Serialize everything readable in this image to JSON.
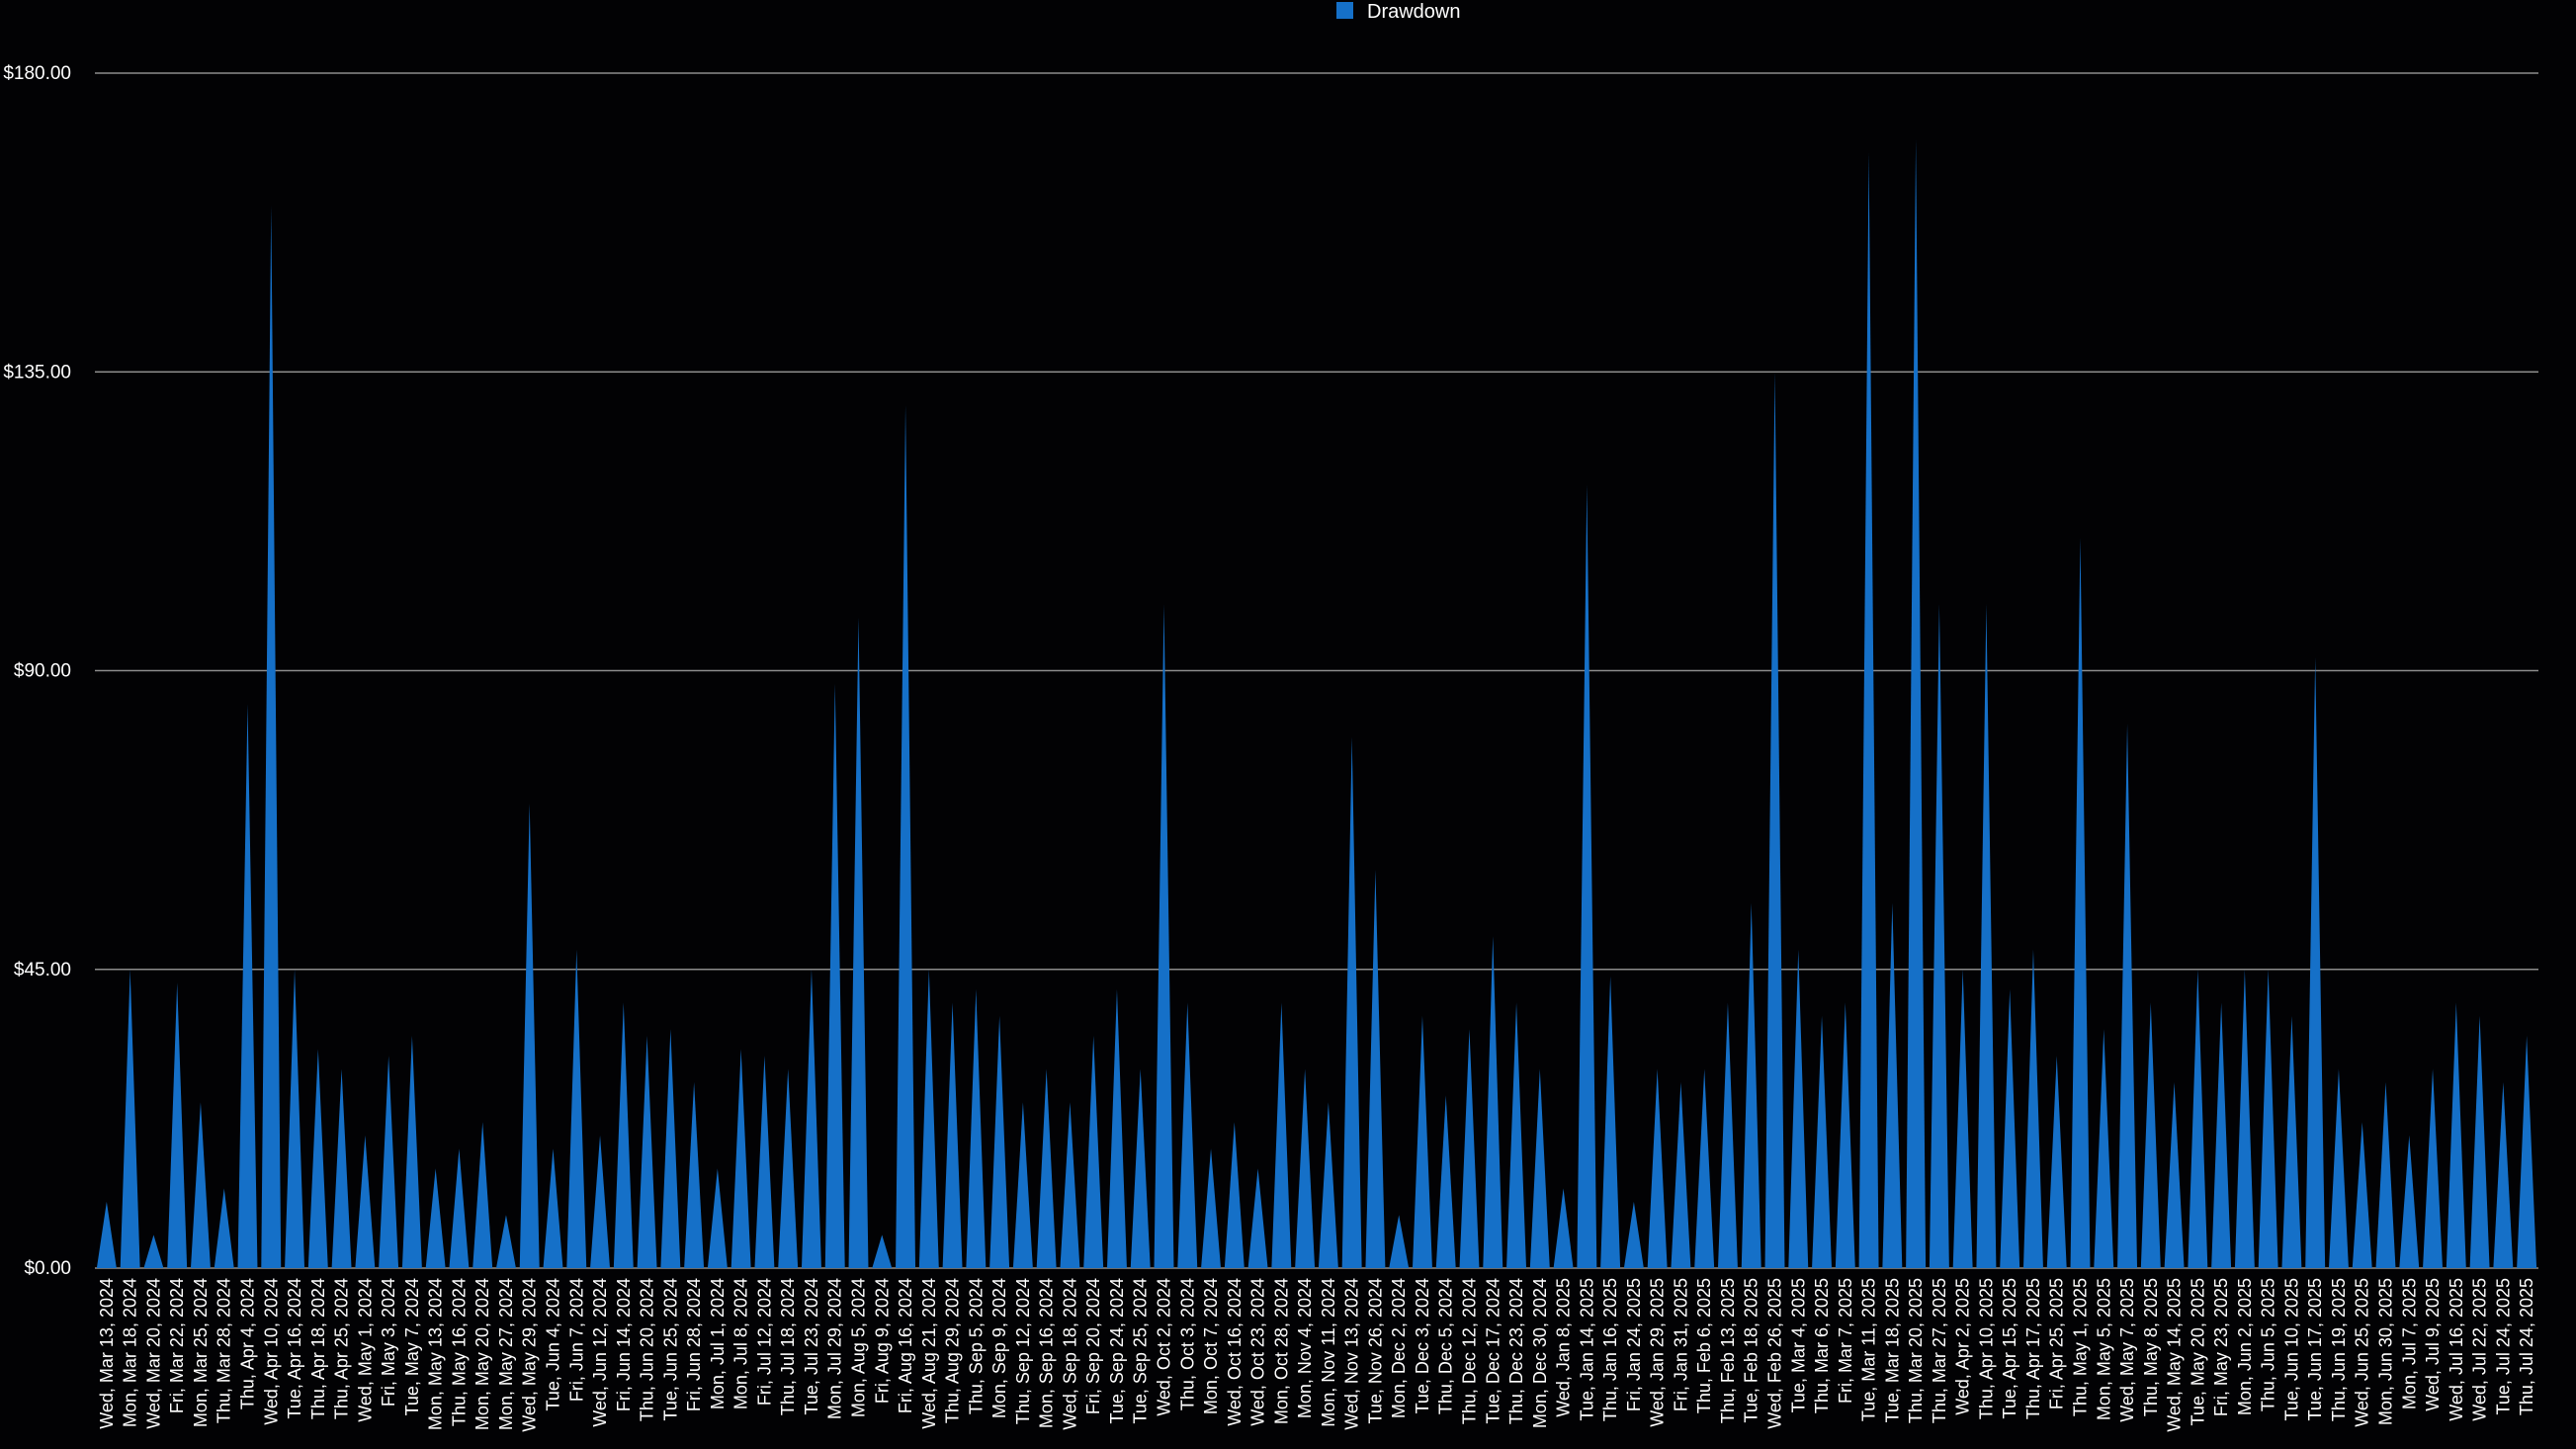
{
  "chart_data": {
    "type": "area",
    "colors": {
      "series": "#1570c8",
      "background": "#020204",
      "grid": "#8c8c8c",
      "text": "#ffffff"
    },
    "legend": {
      "position": "top-center",
      "entries": [
        "Drawdown"
      ]
    },
    "grid": true,
    "ylim": [
      0,
      180
    ],
    "yticks": [
      "$0.00",
      "$45.00",
      "$90.00",
      "$135.00",
      "$180.00"
    ],
    "ytick_values": [
      0,
      45,
      90,
      135,
      180
    ],
    "x": [
      "Wed, Mar 13, 2024",
      "Mon, Mar 18, 2024",
      "Wed, Mar 20, 2024",
      "Fri, Mar 22, 2024",
      "Mon, Mar 25, 2024",
      "Thu, Mar 28, 2024",
      "Thu, Apr 4, 2024",
      "Wed, Apr 10, 2024",
      "Tue, Apr 16, 2024",
      "Thu, Apr 18, 2024",
      "Thu, Apr 25, 2024",
      "Wed, May 1, 2024",
      "Fri, May 3, 2024",
      "Tue, May 7, 2024",
      "Mon, May 13, 2024",
      "Thu, May 16, 2024",
      "Mon, May 20, 2024",
      "Mon, May 27, 2024",
      "Wed, May 29, 2024",
      "Tue, Jun 4, 2024",
      "Fri, Jun 7, 2024",
      "Wed, Jun 12, 2024",
      "Fri, Jun 14, 2024",
      "Thu, Jun 20, 2024",
      "Tue, Jun 25, 2024",
      "Fri, Jun 28, 2024",
      "Mon, Jul 1, 2024",
      "Mon, Jul 8, 2024",
      "Fri, Jul 12, 2024",
      "Thu, Jul 18, 2024",
      "Tue, Jul 23, 2024",
      "Mon, Jul 29, 2024",
      "Mon, Aug 5, 2024",
      "Fri, Aug 9, 2024",
      "Fri, Aug 16, 2024",
      "Wed, Aug 21, 2024",
      "Thu, Aug 29, 2024",
      "Thu, Sep 5, 2024",
      "Mon, Sep 9, 2024",
      "Thu, Sep 12, 2024",
      "Mon, Sep 16, 2024",
      "Wed, Sep 18, 2024",
      "Fri, Sep 20, 2024",
      "Tue, Sep 24, 2024",
      "Tue, Sep 25, 2024",
      "Wed, Oct 2, 2024",
      "Thu, Oct 3, 2024",
      "Mon, Oct 7, 2024",
      "Wed, Oct 16, 2024",
      "Wed, Oct 23, 2024",
      "Mon, Oct 28, 2024",
      "Mon, Nov 4, 2024",
      "Mon, Nov 11, 2024",
      "Wed, Nov 13, 2024",
      "Tue, Nov 26, 2024",
      "Mon, Dec 2, 2024",
      "Tue, Dec 3, 2024",
      "Thu, Dec 5, 2024",
      "Thu, Dec 12, 2024",
      "Tue, Dec 17, 2024",
      "Thu, Dec 23, 2024",
      "Mon, Dec 30, 2024",
      "Wed, Jan 8, 2025",
      "Tue, Jan 14, 2025",
      "Thu, Jan 16, 2025",
      "Fri, Jan 24, 2025",
      "Wed, Jan 29, 2025",
      "Fri, Jan 31, 2025",
      "Thu, Feb 6, 2025",
      "Thu, Feb 13, 2025",
      "Tue, Feb 18, 2025",
      "Wed, Feb 26, 2025",
      "Tue, Mar 4, 2025",
      "Thu, Mar 6, 2025",
      "Fri, Mar 7, 2025",
      "Tue, Mar 11, 2025",
      "Tue, Mar 18, 2025",
      "Thu, Mar 20, 2025",
      "Thu, Mar 27, 2025",
      "Wed, Apr 2, 2025",
      "Thu, Apr 10, 2025",
      "Tue, Apr 15, 2025",
      "Thu, Apr 17, 2025",
      "Fri, Apr 25, 2025",
      "Thu, May 1, 2025",
      "Mon, May 5, 2025",
      "Wed, May 7, 2025",
      "Thu, May 8, 2025",
      "Wed, May 14, 2025",
      "Tue, May 20, 2025",
      "Fri, May 23, 2025",
      "Mon, Jun 2, 2025",
      "Thu, Jun 5, 2025",
      "Tue, Jun 10, 2025",
      "Tue, Jun 17, 2025",
      "Thu, Jun 19, 2025",
      "Wed, Jun 25, 2025",
      "Mon, Jun 30, 2025",
      "Mon, Jul 7, 2025",
      "Wed, Jul 9, 2025",
      "Wed, Jul 16, 2025",
      "Wed, Jul 22, 2025",
      "Tue, Jul 24, 2025",
      "Thu, Jul 24, 2025"
    ],
    "series": [
      {
        "name": "Drawdown",
        "values": [
          10,
          45,
          5,
          43,
          25,
          12,
          85,
          160,
          45,
          33,
          30,
          20,
          32,
          35,
          15,
          18,
          22,
          8,
          70,
          18,
          48,
          20,
          40,
          35,
          36,
          28,
          15,
          33,
          32,
          30,
          45,
          88,
          98,
          5,
          130,
          45,
          40,
          42,
          38,
          25,
          30,
          25,
          35,
          42,
          30,
          100,
          40,
          18,
          22,
          15,
          40,
          30,
          25,
          80,
          60,
          8,
          38,
          26,
          36,
          50,
          40,
          30,
          12,
          118,
          44,
          10,
          30,
          28,
          30,
          40,
          55,
          135,
          48,
          38,
          40,
          168,
          55,
          170,
          100,
          45,
          100,
          42,
          48,
          32,
          110,
          36,
          82,
          40,
          28,
          45,
          40,
          45,
          45,
          38,
          92,
          30,
          22,
          28,
          20,
          30,
          40,
          38,
          28,
          35,
          28
        ]
      }
    ]
  }
}
